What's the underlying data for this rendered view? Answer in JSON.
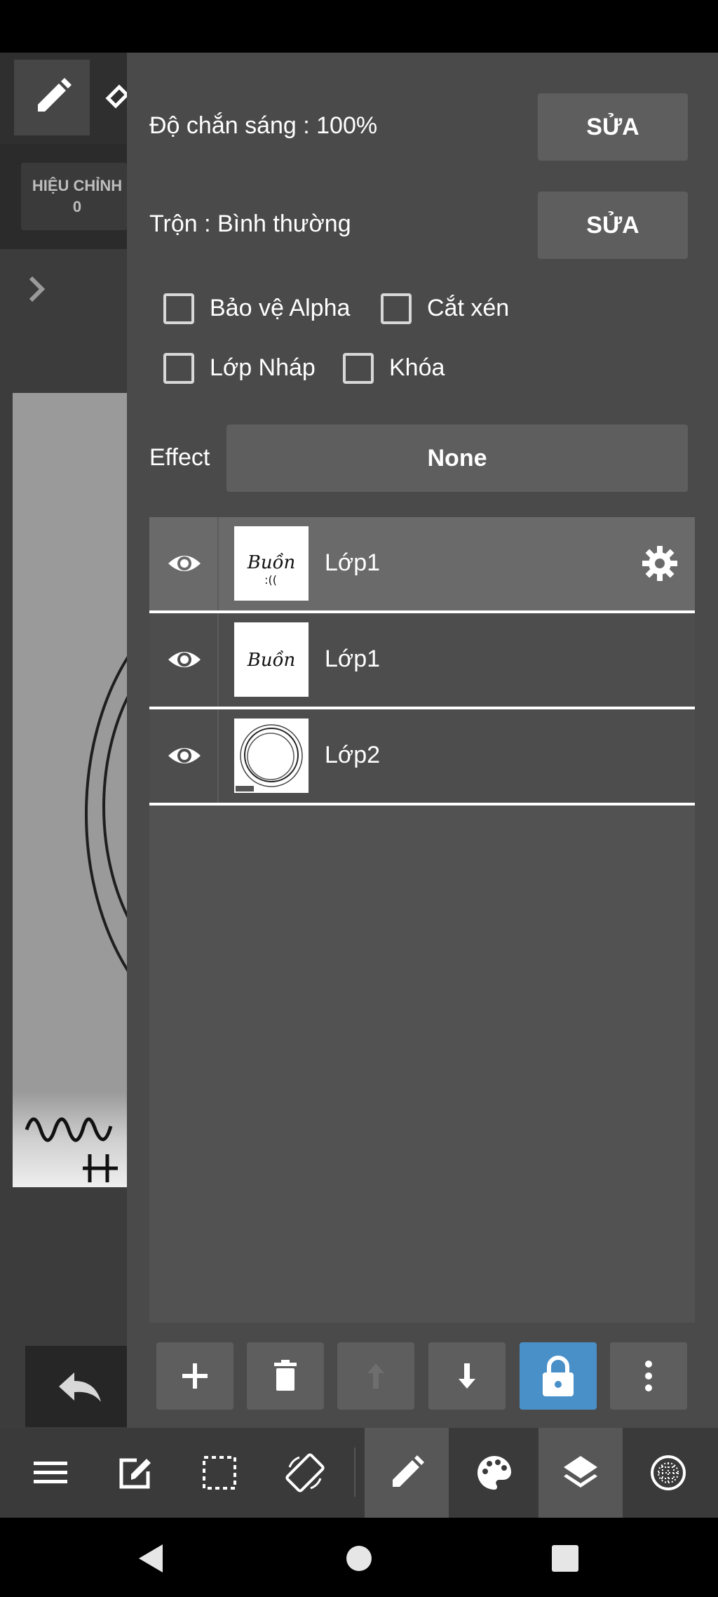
{
  "left_panel": {
    "correction_label": "HIỆU CHỈNH",
    "correction_value": "0"
  },
  "layer_panel": {
    "opacity": {
      "label": "Độ chắn sáng : 100%",
      "edit_button": "SỬA"
    },
    "blend": {
      "label": "Trộn : Bình thường",
      "edit_button": "SỬA"
    },
    "checkboxes": [
      {
        "label": "Bảo vệ Alpha",
        "checked": false
      },
      {
        "label": "Cắt xén",
        "checked": false
      },
      {
        "label": "Lớp Nháp",
        "checked": false
      },
      {
        "label": "Khóa",
        "checked": false
      }
    ],
    "effect": {
      "label": "Effect",
      "value": "None"
    },
    "layers": [
      {
        "name": "Lớp1",
        "visible": true,
        "selected": true,
        "thumb_text": "Buồn"
      },
      {
        "name": "Lớp1",
        "visible": true,
        "selected": false,
        "thumb_text": "Buồn"
      },
      {
        "name": "Lớp2",
        "visible": true,
        "selected": false,
        "thumb_text": ""
      }
    ],
    "actions": [
      "add-icon",
      "trash-icon",
      "arrow-up-icon",
      "arrow-down-icon",
      "lock-icon",
      "more-vertical-icon"
    ]
  },
  "bottom_toolbar": [
    "menu-icon",
    "edit-square-icon",
    "selection-icon",
    "rotate-icon",
    "pen-icon",
    "palette-icon",
    "layers-icon",
    "grid-globe-icon"
  ],
  "colors": {
    "panel_bg": "#4a4a4a",
    "button_bg": "#5e5e5e",
    "lock_active": "#4a90c8"
  }
}
